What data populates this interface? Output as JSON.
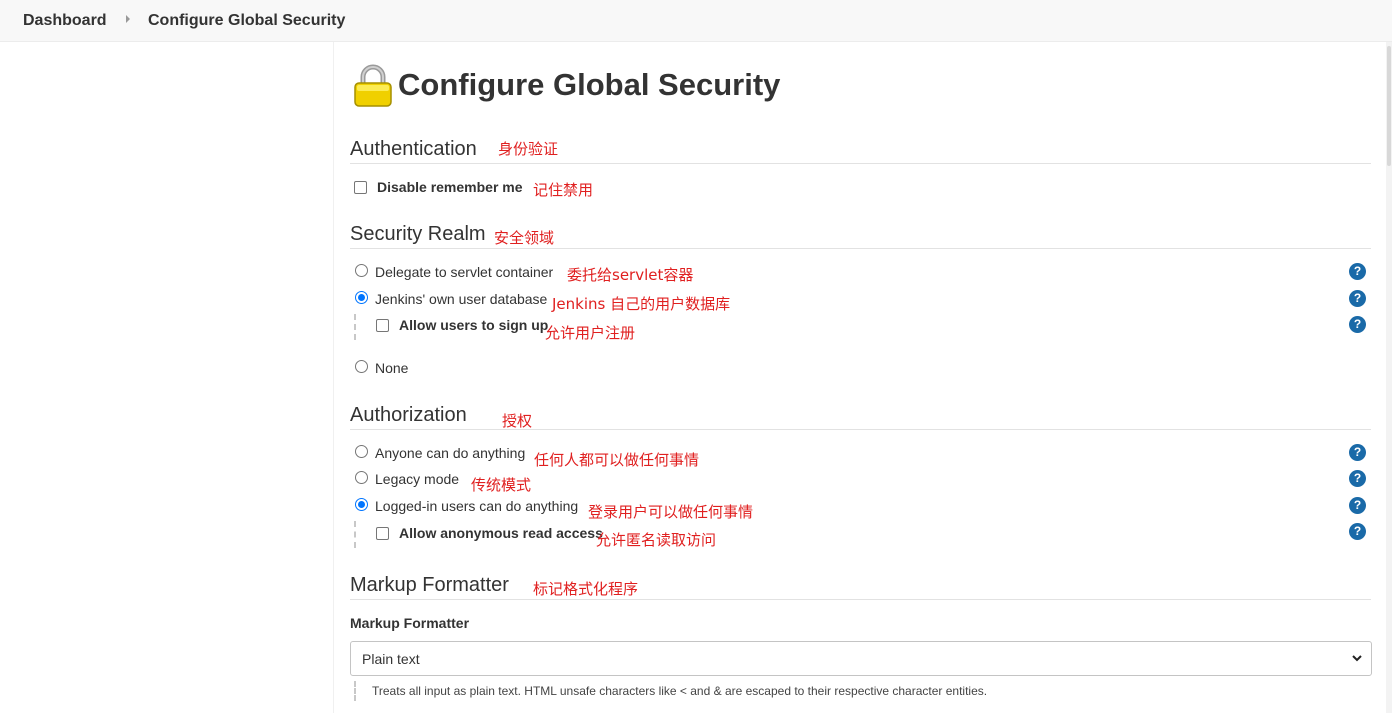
{
  "breadcrumb": {
    "items": [
      "Dashboard",
      "Configure Global Security"
    ]
  },
  "page": {
    "title": "Configure Global Security"
  },
  "sections": {
    "authentication": {
      "title": "Authentication",
      "note": "身份验证",
      "disable_remember_me": {
        "label": "Disable remember me",
        "note": "记住禁用",
        "checked": false
      }
    },
    "security_realm": {
      "title": "Security Realm",
      "note": "安全领域",
      "options": [
        {
          "label": "Delegate to servlet container",
          "note": "委托给servlet容器",
          "selected": false
        },
        {
          "label": "Jenkins' own user database",
          "note": "Jenkins 自己的用户数据库",
          "selected": true
        },
        {
          "label": "None",
          "selected": false
        }
      ],
      "allow_signup": {
        "label": "Allow users to sign up",
        "note": "允许用户注册",
        "checked": false
      }
    },
    "authorization": {
      "title": "Authorization",
      "note": "授权",
      "options": [
        {
          "label": "Anyone can do anything",
          "note": "任何人都可以做任何事情",
          "selected": false
        },
        {
          "label": "Legacy mode",
          "note": "传统模式",
          "selected": false
        },
        {
          "label": "Logged-in users can do anything",
          "note": "登录用户可以做任何事情",
          "selected": true
        }
      ],
      "allow_anonymous_read": {
        "label": "Allow anonymous read access",
        "note": "允许匿名读取访问",
        "checked": false
      }
    },
    "markup_formatter": {
      "title": "Markup Formatter",
      "note": "标记格式化程序",
      "field_label": "Markup Formatter",
      "selected_value": "Plain text",
      "description": "Treats all input as plain text. HTML unsafe characters like < and & are escaped to their respective character entities."
    }
  },
  "help_icon": "?",
  "colors": {
    "annotation": "#e02020",
    "accent": "#0075ff",
    "help": "#1a6aa8"
  }
}
